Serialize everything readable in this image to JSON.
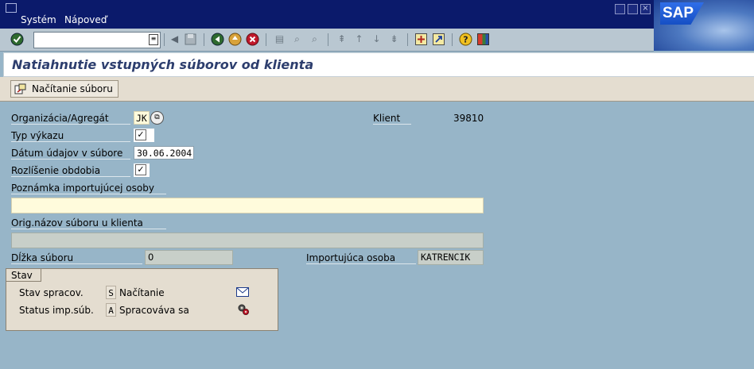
{
  "menu": {
    "items": [
      {
        "label": "Systém"
      },
      {
        "label": "Nápoveď"
      }
    ]
  },
  "brand": {
    "logo_text": "SAP"
  },
  "toolbar": {
    "command_value": "",
    "icons": [
      "enter-icon",
      "save-icon",
      "back-icon",
      "exit-icon",
      "cancel-icon",
      "print-icon",
      "find-icon",
      "find-next-icon",
      "first-page-icon",
      "previous-page-icon",
      "next-page-icon",
      "last-page-icon",
      "new-session-icon",
      "shortcut-icon",
      "help-icon",
      "layout-icon"
    ]
  },
  "title": {
    "text": "Natiahnutie vstupných súborov od klienta"
  },
  "app_toolbar": {
    "load_button_label": "Načítanie súboru"
  },
  "form": {
    "org_label": "Organizácia/Agregát",
    "org_value": "JK",
    "client_label": "Klient",
    "client_value": "39810",
    "report_type_label": "Typ výkazu",
    "report_type_checked": "✓",
    "date_label": "Dátum údajov v súbore",
    "date_value": "30.06.2004",
    "period_label": "Rozlíšenie obdobia",
    "period_checked": "✓",
    "note_label": "Poznámka importujúcej osoby",
    "note_value": "",
    "orig_name_label": "Orig.názov súboru u klienta",
    "orig_name_value": "",
    "length_label": "Dĺžka súboru",
    "length_value": "0",
    "importer_label": "Importujúca osoba",
    "importer_value": "KATRENCIK"
  },
  "status": {
    "group_title": "Stav",
    "processing_label": "Stav spracov.",
    "processing_code": "S",
    "processing_text": "Načítanie",
    "import_label": "Status imp.súb.",
    "import_code": "A",
    "import_text": "Spracováva sa"
  },
  "colors": {
    "background": "#97b5c8",
    "menubar": "#0b1a6b",
    "title_text": "#2d3e6e"
  }
}
